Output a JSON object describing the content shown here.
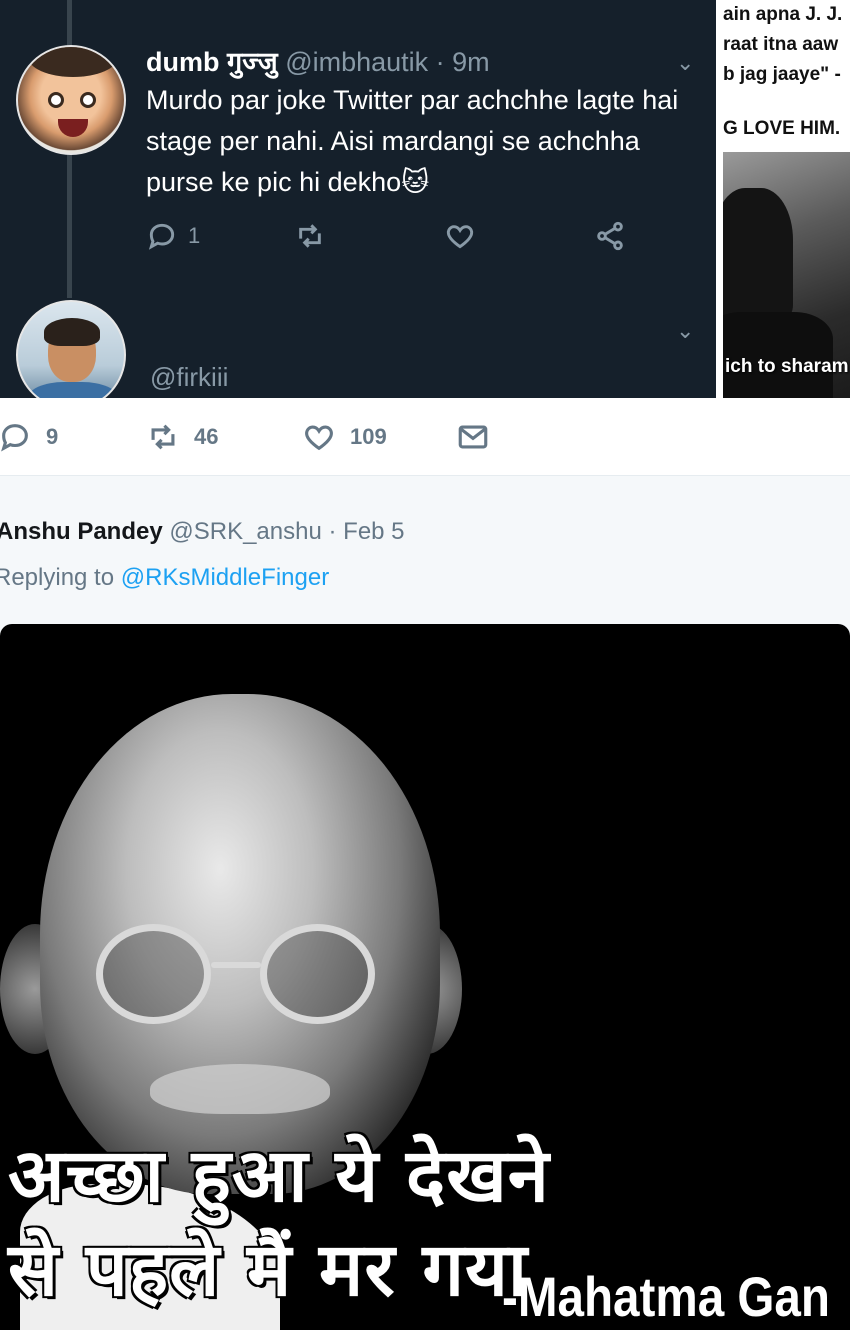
{
  "embedded_tweet": {
    "author_name": "dumb गुज्जु",
    "author_handle": "@imbhautik",
    "time": "· 9m",
    "text": "Murdo par joke Twitter par achchhe lagte hai stage per nahi. Aisi mardangi se achchha purse ke pic hi dekho🐱",
    "reply_count": "1",
    "next_handle": "@firkiii",
    "chevron": "⌄"
  },
  "right_strip": {
    "lines": [
      "ain apna J. J.",
      "raat itna aaw",
      "b jag jaaye\" -",
      "G LOVE HIM."
    ],
    "caption": "ich to sharam k"
  },
  "main_tweet_actions": {
    "replies": "9",
    "retweets": "46",
    "likes": "109"
  },
  "reply": {
    "name": "Anshu Pandey",
    "handle": "@SRK_anshu",
    "date": "· Feb 5",
    "replying_prefix": "Replying to",
    "replying_to": "@RKsMiddleFinger"
  },
  "meme": {
    "line1": "अच्छा हुआ ये देखने",
    "line2": "से पहले मैं मर गया",
    "credit": "-Mahatma Gan"
  },
  "colors": {
    "dark_bg": "#15202b",
    "link": "#1da1f2",
    "muted": "#657786"
  }
}
